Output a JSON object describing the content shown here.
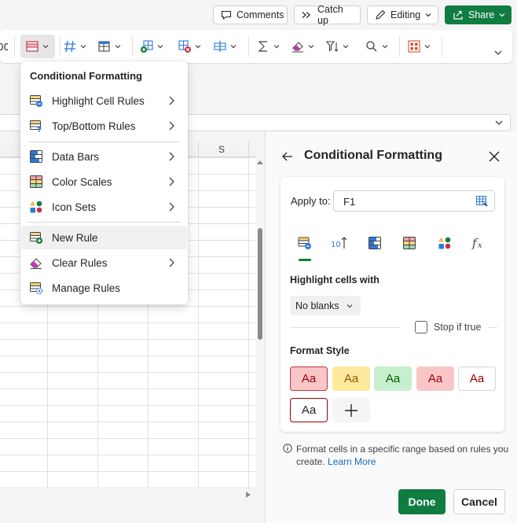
{
  "header": {
    "comments_label": "Comments",
    "catchup_label": "Catch up",
    "editing_label": "Editing",
    "share_label": "Share"
  },
  "ribbon": {
    "icons": [
      "conditional-formatting-icon",
      "number-format-icon",
      "format-as-table-icon",
      "insert-cells-icon",
      "delete-cells-icon",
      "format-cells-icon",
      "autosum-icon",
      "clear-icon",
      "sort-filter-icon",
      "find-icon",
      "add-ins-icon",
      "expand-ribbon-icon"
    ]
  },
  "grid": {
    "column_header_visible": "S"
  },
  "menu": {
    "title": "Conditional Formatting",
    "items": [
      {
        "label": "Highlight Cell Rules",
        "icon": "highlight-cell-rules-icon",
        "submenu": true
      },
      {
        "label": "Top/Bottom Rules",
        "icon": "top-bottom-rules-icon",
        "submenu": true
      },
      {
        "label": "Data Bars",
        "icon": "data-bars-icon",
        "submenu": true
      },
      {
        "label": "Color Scales",
        "icon": "color-scales-icon",
        "submenu": true
      },
      {
        "label": "Icon Sets",
        "icon": "icon-sets-icon",
        "submenu": true
      },
      {
        "label": "New Rule",
        "icon": "new-rule-icon",
        "submenu": false,
        "hovered": true
      },
      {
        "label": "Clear Rules",
        "icon": "clear-rules-icon",
        "submenu": true
      },
      {
        "label": "Manage Rules",
        "icon": "manage-rules-icon",
        "submenu": false
      }
    ]
  },
  "panel": {
    "title": "Conditional Formatting",
    "apply_to_label": "Apply to:",
    "apply_to_value": "F1",
    "highlight_label": "Highlight cells with",
    "highlight_value": "No blanks",
    "stop_if_true_label": "Stop if true",
    "stop_if_true_checked": false,
    "format_style_label": "Format Style",
    "swatch_text": "Aa",
    "swatches": [
      {
        "bg": "#f9c6c7",
        "fg": "#9c0006",
        "border": "#c4314b",
        "selected": true
      },
      {
        "bg": "#fde99c",
        "fg": "#9c5700",
        "border": "#fde99c"
      },
      {
        "bg": "#c6efce",
        "fg": "#006100",
        "border": "#c6efce"
      },
      {
        "bg": "#f9c6c7",
        "fg": "#9c0006",
        "border": "#f9c6c7"
      },
      {
        "bg": "#ffffff",
        "fg": "#9c0006",
        "border": "#d6d6d6"
      },
      {
        "bg": "#ffffff",
        "fg": "#242424",
        "border": "#9c0006"
      }
    ],
    "info_text": "Format cells in a specific range based on rules you create.",
    "learn_more": "Learn More",
    "done_label": "Done",
    "cancel_label": "Cancel"
  },
  "colors": {
    "accent": "#107c41"
  }
}
